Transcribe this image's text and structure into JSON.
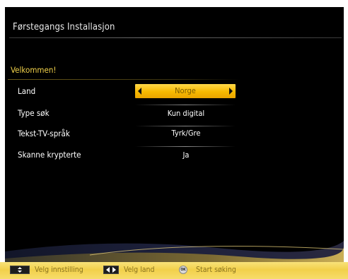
{
  "header": {
    "title": "Førstegangs Installasjon"
  },
  "section": {
    "title": "Velkommen!"
  },
  "settings": [
    {
      "label": "Land",
      "value": "Norge"
    },
    {
      "label": "Type søk",
      "value": "Kun digital"
    },
    {
      "label": "Tekst-TV-språk",
      "value": "Tyrk/Gre"
    },
    {
      "label": "Skanne krypterte",
      "value": "Ja"
    }
  ],
  "footer": {
    "nav_updown": {
      "icon": "up-down-arrows-icon",
      "label": "Velg innstilling"
    },
    "nav_leftright": {
      "icon": "left-right-arrows-icon",
      "label": "Velg land"
    },
    "ok": {
      "icon": "ok-button-icon",
      "key": "OK",
      "label": "Start søking"
    }
  },
  "colors": {
    "accent": "#f7b900",
    "section_title": "#f2d24a",
    "background": "#000000",
    "footer": "#f2d04b"
  }
}
